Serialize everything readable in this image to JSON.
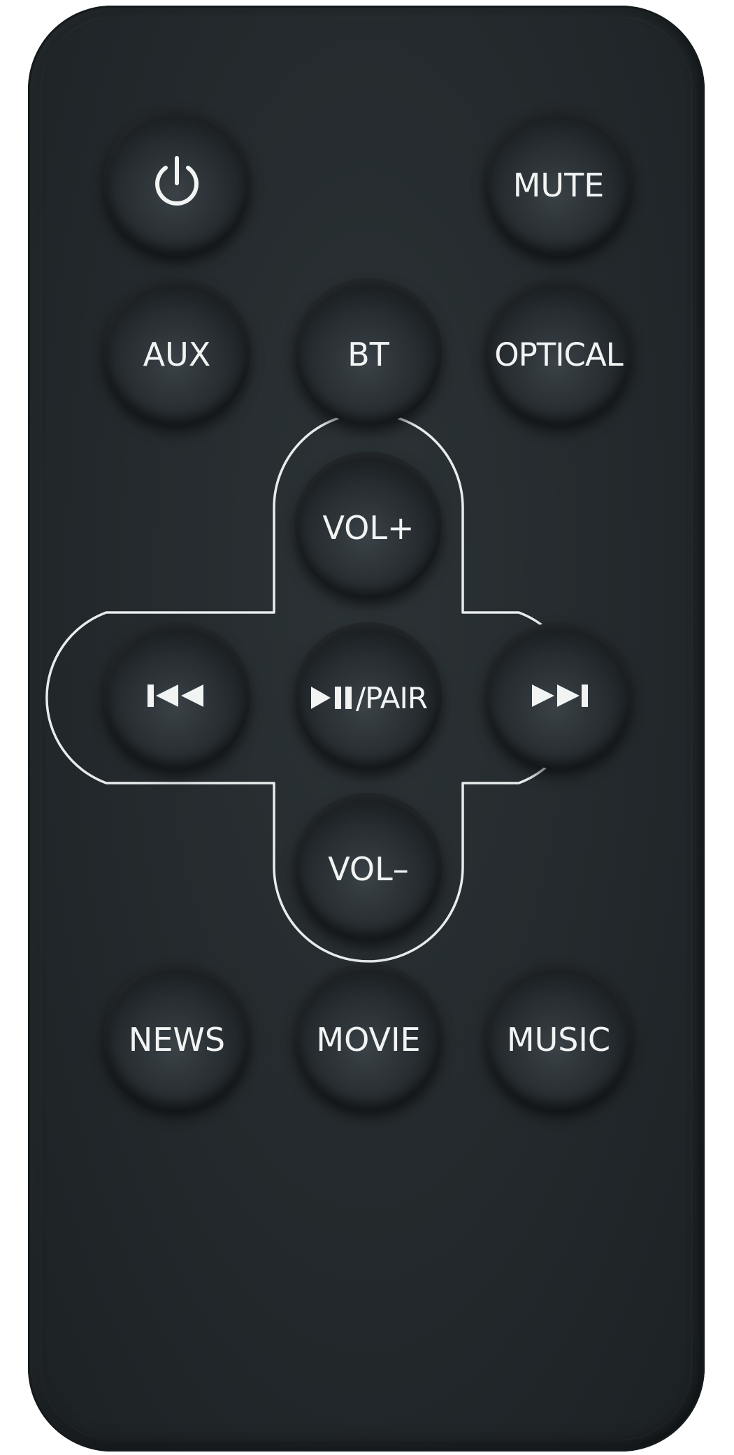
{
  "remote": {
    "buttons": {
      "power": {
        "icon": "power-icon"
      },
      "mute": {
        "label": "MUTE"
      },
      "aux": {
        "label": "AUX"
      },
      "bt": {
        "label": "BT"
      },
      "optical": {
        "label": "OPTICAL"
      },
      "vol_up": {
        "label": "VOL+"
      },
      "prev": {
        "icon": "previous-track-icon"
      },
      "play_pause_pair": {
        "icon": "play-pause-icon",
        "label": "/PAIR"
      },
      "next": {
        "icon": "next-track-icon"
      },
      "vol_down": {
        "label": "VOL–"
      },
      "news": {
        "label": "NEWS"
      },
      "movie": {
        "label": "MOVIE"
      },
      "music": {
        "label": "MUSIC"
      }
    },
    "colors": {
      "body": "#23292c",
      "button": "#272d31",
      "text": "#f2f4f4",
      "outline": "#e8ecec"
    }
  }
}
